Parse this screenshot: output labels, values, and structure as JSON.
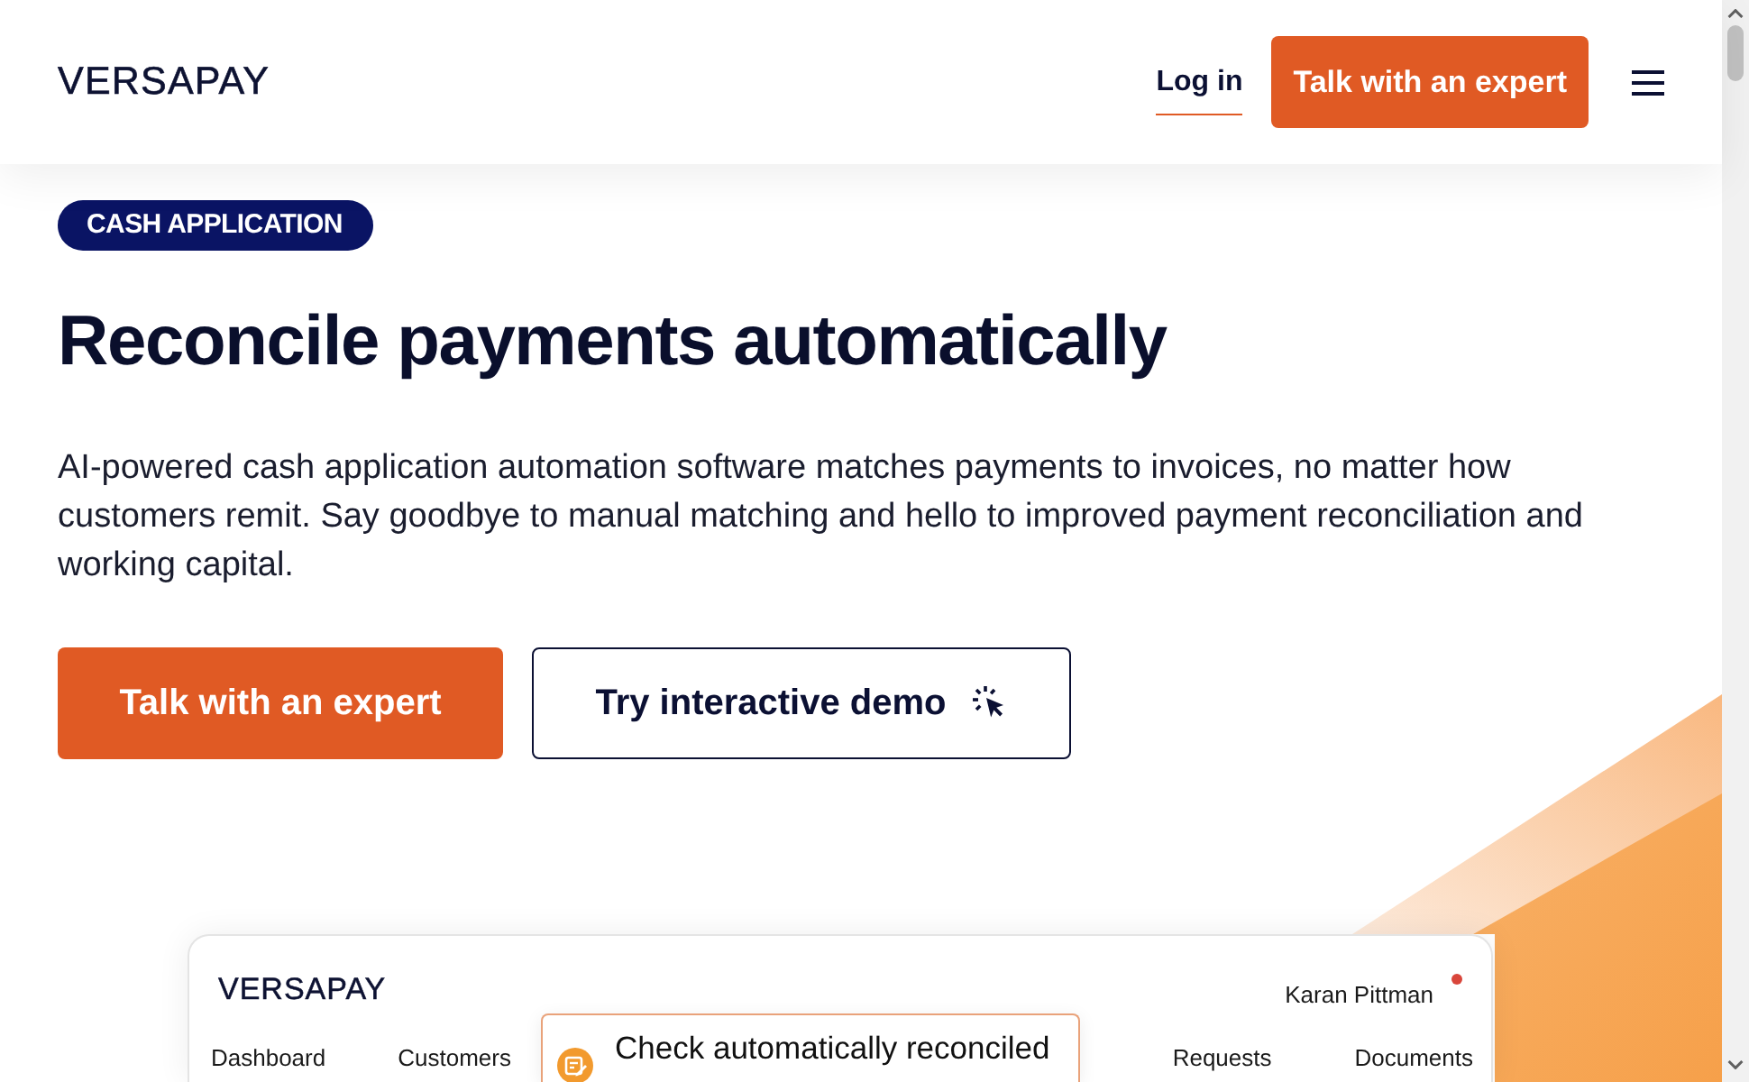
{
  "header": {
    "logo": "VERSAPAY",
    "login_link": "Log in",
    "cta_button": "Talk with an expert"
  },
  "hero": {
    "badge": "CASH APPLICATION",
    "title": "Reconcile payments automatically",
    "description": "AI-powered cash application automation software matches payments to invoices, no matter how customers remit. Say goodbye to manual matching and hello to improved payment reconciliation and working capital.",
    "buttons": [
      {
        "label": "Talk with an expert",
        "kind": "primary"
      },
      {
        "label": "Try interactive demo",
        "kind": "secondary"
      }
    ]
  },
  "dashboard_preview": {
    "logo": "VERSAPAY",
    "user_name": "Karan Pittman",
    "nav": [
      "Dashboard",
      "Customers",
      "Requests",
      "Documents"
    ],
    "notification": "Check automatically reconciled"
  }
}
